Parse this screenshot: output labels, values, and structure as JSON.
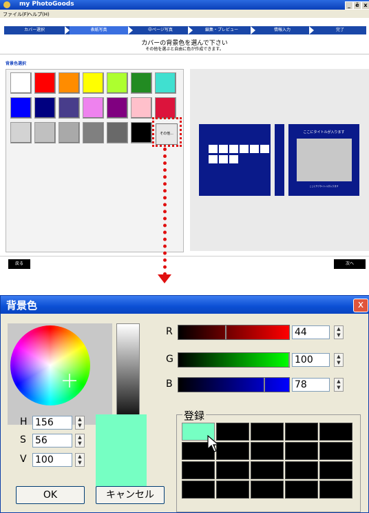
{
  "app": {
    "title": "my PhotoGoods",
    "menu": [
      "ファイル(F)",
      "ヘルプ(H)"
    ],
    "window_buttons": [
      "_",
      "ё",
      "x"
    ]
  },
  "steps": [
    {
      "label": "カバー選択",
      "active": false
    },
    {
      "label": "表紙写真",
      "active": true
    },
    {
      "label": "中ページ写真",
      "active": false
    },
    {
      "label": "編集・プレビュー",
      "active": false
    },
    {
      "label": "情報入力",
      "active": false
    },
    {
      "label": "完了",
      "active": false
    }
  ],
  "main": {
    "heading": "カバーの背景色を選んで下さい",
    "subheading": "その他を選ぶと自由に色が作成できます。",
    "section_label": "背景色選択",
    "swatches": [
      [
        "#ffffff",
        "#ff0000",
        "#ff8c00",
        "#ffff00",
        "#adff2f",
        "#228b22",
        "#40e0d0"
      ],
      [
        "#0000ff",
        "#000080",
        "#483d8b",
        "#ee82ee",
        "#800080",
        "#ffc0cb",
        "#dc143c"
      ],
      [
        "#d3d3d3",
        "#c0c0c0",
        "#a9a9a9",
        "#808080",
        "#696969",
        "#000000"
      ]
    ],
    "other_button": "その他...",
    "cover_preview_title": "ここにタイトルが入ります",
    "cover_preview_subtitle": "ここにサブタイトルが入ります",
    "back_button": "戻る",
    "next_button": "次へ"
  },
  "dialog": {
    "title": "背景色",
    "close": "x",
    "rgb": [
      {
        "label": "R",
        "value": "44"
      },
      {
        "label": "G",
        "value": "100"
      },
      {
        "label": "B",
        "value": "78"
      }
    ],
    "hsv": [
      {
        "label": "H",
        "value": "156"
      },
      {
        "label": "S",
        "value": "56"
      },
      {
        "label": "V",
        "value": "100"
      }
    ],
    "register_label": "登録",
    "ok_button": "OK",
    "cancel_button": "キャンセル",
    "preview_color": "#76ffc3"
  },
  "colors": {
    "accent": "#1a47a8",
    "highlight": "#e01010",
    "cover": "#0a1a8a"
  }
}
